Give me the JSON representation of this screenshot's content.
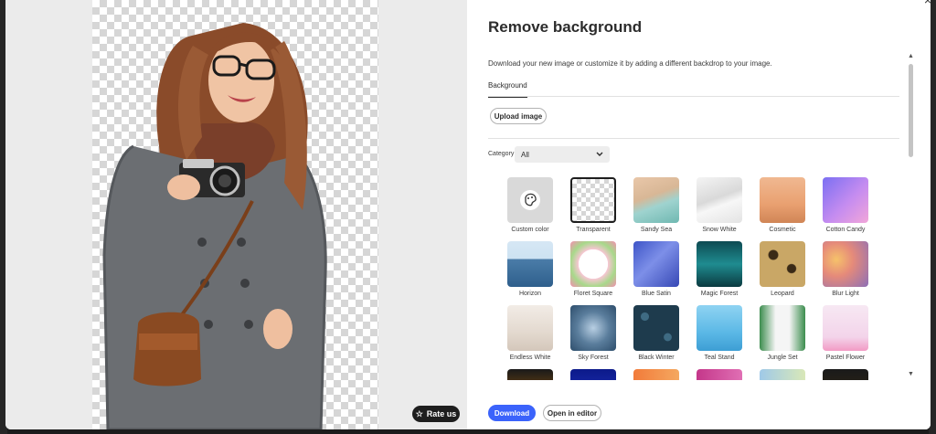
{
  "panel": {
    "title": "Remove background",
    "description": "Download your new image or customize it by adding a different backdrop to your image.",
    "tab_label": "Background",
    "upload_label": "Upload image",
    "category_label": "Category",
    "category_value": "All",
    "close_glyph": "×"
  },
  "preview": {
    "rate_label": "Rate us"
  },
  "tiles": [
    {
      "label": "Custom color",
      "fill": "#d9d9d9",
      "kind": "custom"
    },
    {
      "label": "Transparent",
      "fill": "#ffffff",
      "kind": "transparent",
      "selected": true
    },
    {
      "label": "Sandy Sea",
      "fill": "linear-gradient(160deg,#e9c7a9 0%,#d8b796 40%,#9fd3cf 60%,#6fb8b1 100%)"
    },
    {
      "label": "Snow White",
      "fill": "linear-gradient(160deg,#f4f4f4 0%,#d9d9d9 45%,#f7f7f7 60%,#e3e3e3 100%)"
    },
    {
      "label": "Cosmetic",
      "fill": "linear-gradient(180deg,#f0b891 0%,#e9a070 60%,#d08556 100%)"
    },
    {
      "label": "Cotton Candy",
      "fill": "linear-gradient(135deg,#7b6ff2 0%,#c58cf0 55%,#f2a6d9 100%)"
    },
    {
      "label": "Horizon",
      "fill": "linear-gradient(180deg,#d6e7f4 0%,#cde2f2 38%,#4a7ca8 40%,#2f5f8c 100%)"
    },
    {
      "label": "Floret Square",
      "fill": "radial-gradient(circle,#ffffff 45%,#f7c6d3 46%,#a7d98a 70%,#f48fb1 100%)"
    },
    {
      "label": "Blue Satin",
      "fill": "linear-gradient(135deg,#3e55c8 0%,#7d8fe8 45%,#3648b5 100%)"
    },
    {
      "label": "Magic Forest",
      "fill": "linear-gradient(180deg,#0d4a52 0%,#1f8c90 50%,#0b3a40 100%)"
    },
    {
      "label": "Leopard",
      "fill": "radial-gradient(circle at 30% 30%,#3a2a16 10%,transparent 12%),radial-gradient(circle at 70% 60%,#3a2a16 10%,transparent 12%),#c9a766"
    },
    {
      "label": "Blur Light",
      "fill": "radial-gradient(circle at 30% 40%,#f6c26a 0%,#e58a7a 40%,#8d6fb7 100%)"
    },
    {
      "label": "Endless White",
      "fill": "linear-gradient(180deg,#f2ece6 0%,#e3d9cf 60%,#d4c7bb 100%)"
    },
    {
      "label": "Sky Forest",
      "fill": "radial-gradient(circle,#b8cfe3 0%,#5a7d9c 50%,#2e4e6c 100%)"
    },
    {
      "label": "Black Winter",
      "fill": "radial-gradient(circle at 25% 25%,#3f6b83 8%,transparent 9%),radial-gradient(circle at 75% 70%,#3f6b83 8%,transparent 9%),#1e3b4d"
    },
    {
      "label": "Teal Stand",
      "fill": "linear-gradient(180deg,#8fd3f2 0%,#5bb8e6 60%,#3d9ed4 100%)"
    },
    {
      "label": "Jungle Set",
      "fill": "linear-gradient(90deg,#3c8d4e 0%,#f5f5f5 35%,#f5f5f5 65%,#3c8d4e 100%)"
    },
    {
      "label": "Pastel Flower",
      "fill": "linear-gradient(180deg,#f7e8f3 0%,#f3d4ea 70%,#f29ac4 100%)"
    },
    {
      "label": "",
      "fill": "linear-gradient(180deg,#1a1a1a 0%,#5a3a12 40%,#2a2a2a 100%)"
    },
    {
      "label": "",
      "fill": "linear-gradient(180deg,#0c1a8a 0%,#2538c9 100%)"
    },
    {
      "label": "",
      "fill": "linear-gradient(90deg,#f27b3a 0%,#f4a860 100%)"
    },
    {
      "label": "",
      "fill": "linear-gradient(90deg,#c4378a 0%,#e06fb4 100%)"
    },
    {
      "label": "",
      "fill": "linear-gradient(90deg,#9fc9e8 0%,#d9e8b8 100%)"
    },
    {
      "label": "",
      "fill": "linear-gradient(180deg,#1a1a1a 0%,#3a2a10 100%)"
    }
  ],
  "footer": {
    "download_label": "Download",
    "editor_label": "Open in editor"
  },
  "colors": {
    "primary": "#3b63fb",
    "dark": "#1e1e1e"
  }
}
